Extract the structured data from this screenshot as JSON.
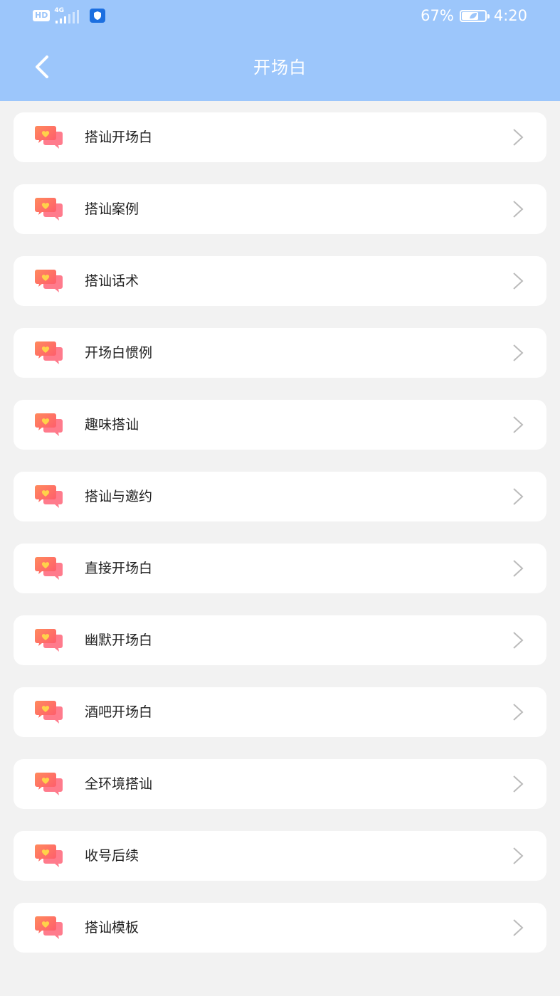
{
  "status_bar": {
    "hd": "HD",
    "network": "4G",
    "battery_text": "67%",
    "battery_level": 0.67,
    "time": "4:20"
  },
  "header": {
    "title": "开场白",
    "back_icon": "chevron-left-icon",
    "background": "#9cc6fb"
  },
  "items": [
    {
      "label": "搭讪开场白",
      "icon": "chat-heart-icon"
    },
    {
      "label": "搭讪案例",
      "icon": "chat-heart-icon"
    },
    {
      "label": "搭讪话术",
      "icon": "chat-heart-icon"
    },
    {
      "label": "开场白惯例",
      "icon": "chat-heart-icon"
    },
    {
      "label": "趣味搭讪",
      "icon": "chat-heart-icon"
    },
    {
      "label": "搭讪与邀约",
      "icon": "chat-heart-icon"
    },
    {
      "label": "直接开场白",
      "icon": "chat-heart-icon"
    },
    {
      "label": "幽默开场白",
      "icon": "chat-heart-icon"
    },
    {
      "label": "酒吧开场白",
      "icon": "chat-heart-icon"
    },
    {
      "label": "全环境搭讪",
      "icon": "chat-heart-icon"
    },
    {
      "label": "收号后续",
      "icon": "chat-heart-icon"
    },
    {
      "label": "搭讪模板",
      "icon": "chat-heart-icon"
    }
  ],
  "colors": {
    "icon_gradient_start": "#ff5a6e",
    "icon_gradient_end": "#ff8a5c",
    "heart": "#ffd24a",
    "arrow": "#bbbbbb"
  }
}
